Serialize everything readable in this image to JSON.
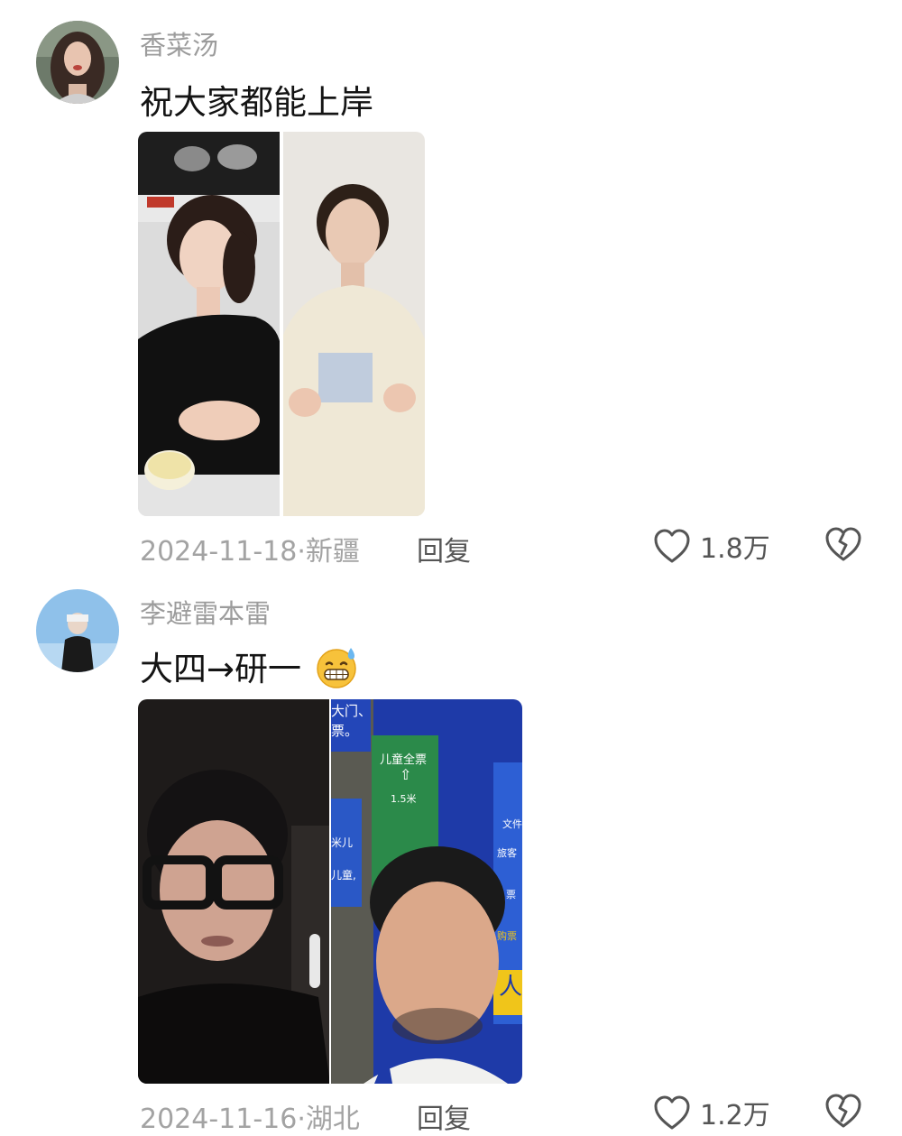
{
  "comments": [
    {
      "username": "香菜汤",
      "text": "祝大家都能上岸",
      "date": "2024-11-18",
      "separator": "·",
      "location": "新疆",
      "reply_label": "回复",
      "likes": "1.8万"
    },
    {
      "username": "李避雷本雷",
      "text": "大四→研一",
      "emoji": "grinning-sweat-emoji",
      "date": "2024-11-16",
      "separator": "·",
      "location": "湖北",
      "reply_label": "回复",
      "likes": "1.2万",
      "photo_signs": {
        "sign_top": "大门、",
        "sign_top2": "票。",
        "sign_green_title": "儿童全票",
        "sign_height": "1.5米",
        "sign_blue_mid": "米儿",
        "sign_blue_mid2": "儿童,",
        "sign_right_1": "文件",
        "sign_right_2": "旅客",
        "sign_right_3": "票",
        "sign_right_4": "购票",
        "sign_right_big": "人"
      }
    }
  ],
  "colors": {
    "username": "#9c9c9c",
    "text": "#141414",
    "meta": "#a3a3a3",
    "action": "#555555"
  }
}
